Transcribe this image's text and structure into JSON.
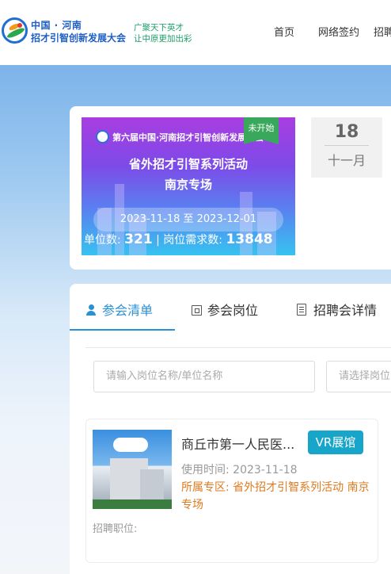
{
  "header": {
    "logo_line1": "中国 · 河南",
    "logo_line2": "招才引智创新发展大会",
    "slogan_line1": "广聚天下英才",
    "slogan_line2": "让中原更加出彩",
    "nav": [
      {
        "label": "首页"
      },
      {
        "label": "网络签约"
      },
      {
        "label": "招聘"
      }
    ]
  },
  "fair": {
    "banner_title": "第六届中国·河南招才引智创新发展大会",
    "banner_subtitle": "省外招才引智系列活动",
    "banner_city": "南京专场",
    "status": "未开始",
    "date_range": "2023-11-18 至 2023-12-01",
    "units_label": "单位数: ",
    "units_value": "321",
    "jobs_label": " | 岗位需求数: ",
    "jobs_value": "13848",
    "day": "18",
    "month": "十一月"
  },
  "tabs": [
    {
      "label": "参会清单",
      "active": true
    },
    {
      "label": "参会岗位",
      "active": false
    },
    {
      "label": "招聘会详情",
      "active": false
    }
  ],
  "search": {
    "keyword_placeholder": "请输入岗位名称/单位名称",
    "select_placeholder": "请选择岗位"
  },
  "company": {
    "name": "商丘市第一人民医...",
    "vr_label": "VR展馆",
    "use_time_label": "使用时间:",
    "use_time": "2023-11-18",
    "zone_label": "所属专区:",
    "zone": "省外招才引智系列活动 南京专场",
    "recruit_label": "招聘职位:"
  },
  "colors": {
    "accent": "#2b8fd6",
    "vr_button": "#17a6c9",
    "zone_text": "#e07a1f",
    "status_tag": "#3aa85c"
  }
}
